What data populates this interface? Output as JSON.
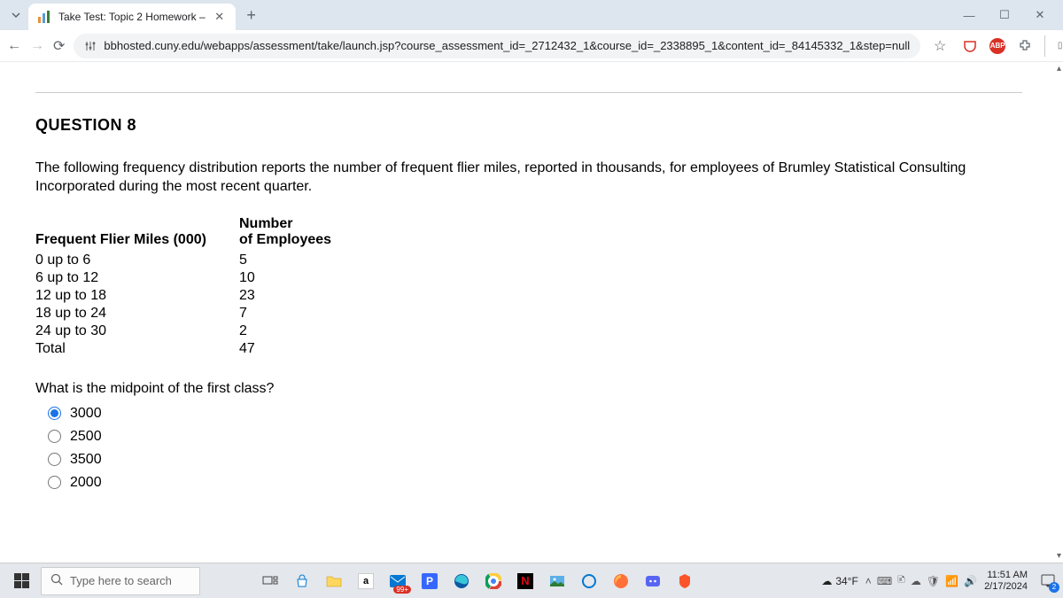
{
  "browser": {
    "tab_title": "Take Test: Topic 2 Homework – ",
    "url": "bbhosted.cuny.edu/webapps/assessment/take/launch.jsp?course_assessment_id=_2712432_1&course_id=_2338895_1&content_id=_84145332_1&step=null",
    "abp_label": "ABP"
  },
  "question": {
    "heading": "QUESTION 8",
    "prompt": "The following frequency distribution reports the number of frequent flier miles, reported in thousands, for employees of Brumley Statistical Consulting Incorporated during the most recent quarter.",
    "table_header_left": "Frequent Flier Miles (000)",
    "table_header_right": "Number of Employees",
    "table_rows": [
      {
        "range": "0 up to 6",
        "count": "5"
      },
      {
        "range": "6 up to 12",
        "count": "10"
      },
      {
        "range": "12 up to 18",
        "count": "23"
      },
      {
        "range": "18 up to 24",
        "count": "7"
      },
      {
        "range": "24 up to 30",
        "count": "2"
      },
      {
        "range": "Total",
        "count": "47"
      }
    ],
    "subquestion": "What is the midpoint of the first class?",
    "options": [
      "3000",
      "2500",
      "3500",
      "2000"
    ],
    "selected": 0
  },
  "taskbar": {
    "search_placeholder": "Type here to search",
    "temperature": "34°F",
    "time": "11:51 AM",
    "date": "2/17/2024",
    "notif_count": "2",
    "mail_badge": "99+"
  }
}
